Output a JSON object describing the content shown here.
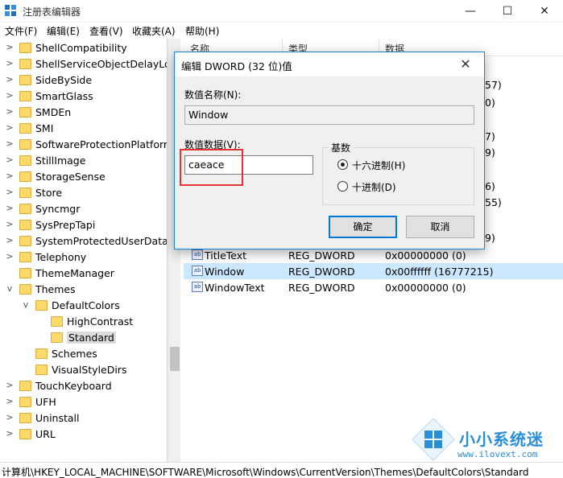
{
  "window": {
    "title": "注册表编辑器",
    "minimize_glyph": "—",
    "maximize_glyph": "☐",
    "close_glyph": "✕"
  },
  "menu": [
    "文件(F)",
    "编辑(E)",
    "查看(V)",
    "收藏夹(A)",
    "帮助(H)"
  ],
  "tree": {
    "items": [
      {
        "label": "ShellCompatibility",
        "depth": 1,
        "expander": ">"
      },
      {
        "label": "ShellServiceObjectDelayLoad",
        "depth": 1,
        "expander": ">"
      },
      {
        "label": "SideBySide",
        "depth": 1,
        "expander": ">"
      },
      {
        "label": "SmartGlass",
        "depth": 1,
        "expander": ">"
      },
      {
        "label": "SMDEn",
        "depth": 1,
        "expander": ">"
      },
      {
        "label": "SMI",
        "depth": 1,
        "expander": ">"
      },
      {
        "label": "SoftwareProtectionPlatform",
        "depth": 1,
        "expander": ">"
      },
      {
        "label": "StillImage",
        "depth": 1,
        "expander": ">"
      },
      {
        "label": "StorageSense",
        "depth": 1,
        "expander": ">"
      },
      {
        "label": "Store",
        "depth": 1,
        "expander": ">"
      },
      {
        "label": "Syncmgr",
        "depth": 1,
        "expander": ">"
      },
      {
        "label": "SysPrepTapi",
        "depth": 1,
        "expander": ">"
      },
      {
        "label": "SystemProtectedUserData",
        "depth": 1,
        "expander": ">"
      },
      {
        "label": "Telephony",
        "depth": 1,
        "expander": ">"
      },
      {
        "label": "ThemeManager",
        "depth": 1,
        "expander": ""
      },
      {
        "label": "Themes",
        "depth": 1,
        "expander": "v"
      },
      {
        "label": "DefaultColors",
        "depth": 2,
        "expander": "v"
      },
      {
        "label": "HighContrast",
        "depth": 3,
        "expander": ""
      },
      {
        "label": "Standard",
        "depth": 3,
        "expander": "",
        "selected": true
      },
      {
        "label": "Schemes",
        "depth": 2,
        "expander": ""
      },
      {
        "label": "VisualStyleDirs",
        "depth": 2,
        "expander": ""
      },
      {
        "label": "TouchKeyboard",
        "depth": 1,
        "expander": ">"
      },
      {
        "label": "UFH",
        "depth": 1,
        "expander": ">"
      },
      {
        "label": "Uninstall",
        "depth": 1,
        "expander": ">"
      },
      {
        "label": "URL",
        "depth": 1,
        "expander": ">"
      }
    ]
  },
  "list": {
    "headers": [
      "名称",
      "类型",
      "数据"
    ],
    "partial_values": [
      "57)",
      "0)",
      "7)",
      "9)",
      "6)",
      "55)",
      "9)"
    ],
    "rows": [
      {
        "name": "TitleText",
        "type": "REG_DWORD",
        "data": "0x00000000 (0)"
      },
      {
        "name": "Window",
        "type": "REG_DWORD",
        "data": "0x00ffffff (16777215)",
        "selected": true
      },
      {
        "name": "WindowText",
        "type": "REG_DWORD",
        "data": "0x00000000 (0)"
      }
    ],
    "row_icon_text": "ab"
  },
  "status": {
    "path": "计算机\\HKEY_LOCAL_MACHINE\\SOFTWARE\\Microsoft\\Windows\\CurrentVersion\\Themes\\DefaultColors\\Standard"
  },
  "dialog": {
    "title": "编辑 DWORD (32 位)值",
    "close_glyph": "✕",
    "value_name_label": "数值名称(N):",
    "value_name": "Window",
    "value_data_label": "数值数据(V):",
    "value_data": "caeace",
    "base_label": "基数",
    "hex_label": "十六进制(H)",
    "dec_label": "十进制(D)",
    "ok_label": "确定",
    "cancel_label": "取消",
    "selected_base": "hex"
  },
  "watermark": {
    "text": "小小系统迷",
    "url": "www.ilovext.com"
  },
  "colors": {
    "accent": "#0078d7",
    "selection": "#cce8ff",
    "folder": "#fcd96b",
    "highlight": "#e53333"
  }
}
